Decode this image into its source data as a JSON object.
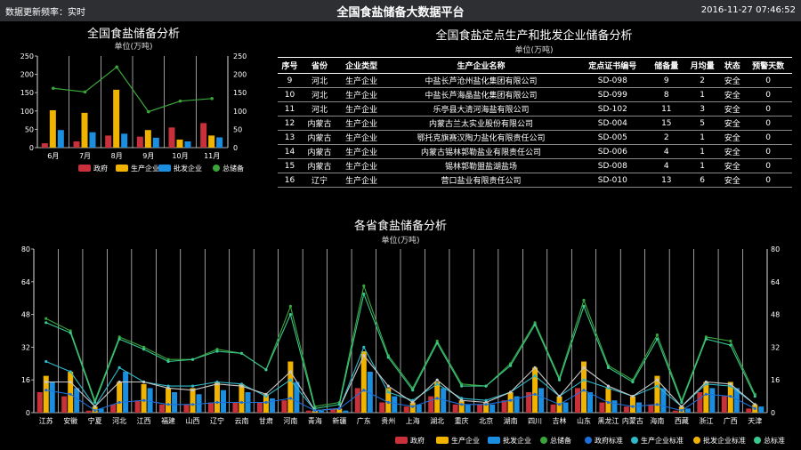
{
  "header": {
    "refresh": "数据更新频率：实时",
    "title": "全国食盐储备大数据平台",
    "datetime": "2016-11-27 07:46:52"
  },
  "top_chart": {
    "title": "全国食盐储备分析",
    "unit": "单位(万吨)"
  },
  "table": {
    "title": "全国食盐定点生产和批发企业储备分析",
    "unit": "单位(万吨)",
    "columns": [
      "序号",
      "省份",
      "企业类型",
      "生产企业名称",
      "定点证书编号",
      "储备量",
      "月均量",
      "状态",
      "预警天数"
    ],
    "rows": [
      [
        "9",
        "河北",
        "生产企业",
        "中盐长芦沧州盐化集团有限公司",
        "SD-098",
        "9",
        "2",
        "安全",
        "0"
      ],
      [
        "10",
        "河北",
        "生产企业",
        "中盐长芦海晶盐化集团有限公司",
        "SD-099",
        "8",
        "1",
        "安全",
        "0"
      ],
      [
        "11",
        "河北",
        "生产企业",
        "乐亭县大清河海盐有限公司",
        "SD-102",
        "11",
        "3",
        "安全",
        "0"
      ],
      [
        "12",
        "内蒙古",
        "生产企业",
        "内蒙古兰太实业股份有限公司",
        "SD-004",
        "15",
        "5",
        "安全",
        "0"
      ],
      [
        "13",
        "内蒙古",
        "生产企业",
        "鄂托克旗赛汉陶力盐化有限责任公司",
        "SD-005",
        "2",
        "1",
        "安全",
        "0"
      ],
      [
        "14",
        "内蒙古",
        "生产企业",
        "内蒙古锡林郭勒盐业有限责任公司",
        "SD-006",
        "4",
        "1",
        "安全",
        "0"
      ],
      [
        "15",
        "内蒙古",
        "生产企业",
        "锡林郭勒盟盐湖盐场",
        "SD-008",
        "4",
        "1",
        "安全",
        "0"
      ],
      [
        "16",
        "辽宁",
        "生产企业",
        "营口盐业有限责任公司",
        "SD-010",
        "13",
        "6",
        "安全",
        "0"
      ]
    ]
  },
  "bottom_chart": {
    "title": "各省食盐储备分析",
    "unit": "单位(万吨)"
  },
  "colors": {
    "gov": "#c8303a",
    "prod": "#f0b400",
    "whole": "#1c8ee0",
    "total": "#3aa63a",
    "gov_std": "#1c6fd8",
    "prod_std": "#2fb8c8",
    "whole_std": "#f0b400",
    "total_std": "#38c890",
    "tealline": "#38c890"
  },
  "chart_data": [
    {
      "type": "bar",
      "title": "全国食盐储备分析",
      "ylabel": "单位(万吨)",
      "categories": [
        "6月",
        "7月",
        "8月",
        "9月",
        "10月",
        "11月"
      ],
      "ylim": [
        0,
        250
      ],
      "y2lim": [
        0,
        250
      ],
      "series": [
        {
          "name": "政府",
          "values": [
            12,
            17,
            33,
            30,
            55,
            67
          ]
        },
        {
          "name": "生产企业",
          "values": [
            102,
            95,
            158,
            48,
            22,
            33
          ]
        },
        {
          "name": "批发企业",
          "values": [
            48,
            42,
            38,
            27,
            17,
            28
          ]
        },
        {
          "name": "总储备",
          "values": [
            162,
            152,
            220,
            98,
            127,
            134
          ]
        }
      ]
    },
    {
      "type": "bar",
      "title": "各省食盐储备分析",
      "ylabel": "单位(万吨)",
      "categories": [
        "江苏",
        "安徽",
        "宁夏",
        "河北",
        "江西",
        "福建",
        "山西",
        "辽宁",
        "云南",
        "甘肃",
        "河南",
        "青海",
        "新疆",
        "广东",
        "贵州",
        "上海",
        "湖北",
        "重庆",
        "北京",
        "湖南",
        "四川",
        "吉林",
        "山东",
        "黑龙江",
        "内蒙古",
        "海南",
        "西藏",
        "浙江",
        "广西",
        "天津"
      ],
      "ylim": [
        0,
        80
      ],
      "y2lim": [
        0,
        80
      ],
      "series": [
        {
          "name": "政府",
          "values": [
            10,
            8,
            1,
            4,
            6,
            4,
            4,
            5,
            5,
            5,
            6,
            1,
            2,
            12,
            5,
            3,
            8,
            4,
            4,
            6,
            10,
            4,
            12,
            5,
            3,
            4,
            1,
            10,
            8,
            2
          ]
        },
        {
          "name": "生产企业",
          "values": [
            18,
            20,
            3,
            15,
            14,
            12,
            12,
            15,
            14,
            9,
            25,
            1,
            2,
            30,
            12,
            5,
            15,
            6,
            5,
            10,
            22,
            8,
            25,
            12,
            8,
            18,
            3,
            15,
            15,
            4
          ]
        },
        {
          "name": "批发企业",
          "values": [
            15,
            12,
            2,
            20,
            12,
            10,
            9,
            11,
            10,
            7,
            15,
            1,
            1,
            20,
            8,
            4,
            12,
            4,
            4,
            8,
            12,
            5,
            10,
            6,
            5,
            12,
            2,
            12,
            12,
            3
          ]
        },
        {
          "name": "总储备",
          "values": [
            46,
            40,
            6,
            37,
            32,
            26,
            26,
            31,
            29,
            21,
            52,
            3,
            5,
            62,
            28,
            12,
            35,
            14,
            13,
            24,
            44,
            17,
            55,
            23,
            16,
            38,
            6,
            37,
            35,
            9
          ]
        },
        {
          "name": "政府标准",
          "values": [
            11,
            9,
            1,
            5,
            6,
            4,
            4,
            5,
            5,
            5,
            7,
            1,
            2,
            11,
            5,
            3,
            7,
            4,
            4,
            6,
            9,
            4,
            11,
            5,
            3,
            4,
            1,
            9,
            8,
            2
          ]
        },
        {
          "name": "生产企业标准",
          "values": [
            25,
            20,
            3,
            22,
            15,
            13,
            13,
            15,
            14,
            8,
            16,
            1,
            2,
            32,
            10,
            6,
            14,
            7,
            6,
            10,
            18,
            8,
            16,
            12,
            8,
            13,
            3,
            14,
            13,
            4
          ]
        },
        {
          "name": "批发企业标准",
          "values": [
            15,
            15,
            3,
            15,
            15,
            12,
            11,
            14,
            13,
            9,
            20,
            1,
            2,
            28,
            13,
            5,
            16,
            6,
            5,
            10,
            22,
            8,
            22,
            13,
            8,
            16,
            3,
            15,
            14,
            4
          ]
        },
        {
          "name": "总标准",
          "values": [
            44,
            39,
            5,
            36,
            31,
            25,
            26,
            30,
            29,
            21,
            48,
            2,
            4,
            58,
            27,
            11,
            34,
            13,
            13,
            23,
            43,
            16,
            52,
            22,
            15,
            36,
            5,
            36,
            33,
            8
          ]
        }
      ]
    }
  ]
}
